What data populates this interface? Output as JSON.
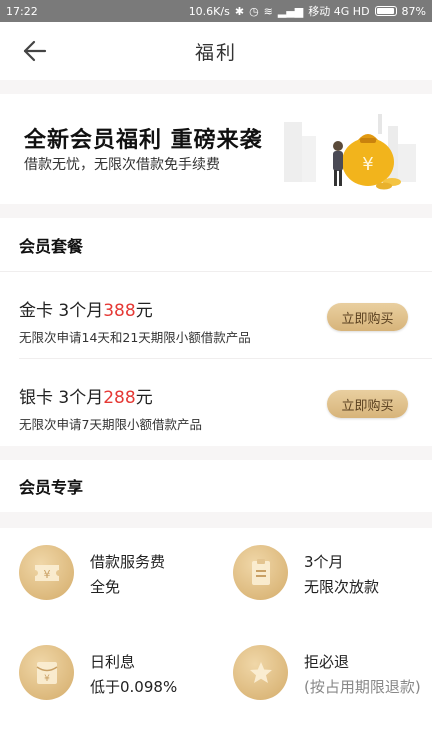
{
  "status_bar": {
    "time": "17:22",
    "network_speed": "10.6K/s",
    "carrier": "移动 4G HD",
    "battery": "87%"
  },
  "nav": {
    "title": "福利",
    "back_icon": "arrow-left-icon"
  },
  "banner": {
    "title": "全新会员福利 重磅来袭",
    "subtitle": "借款无忧，无限次借款免手续费"
  },
  "packages": {
    "header": "会员套餐",
    "items": [
      {
        "name": "金卡 3个月",
        "price": "388",
        "unit": "元",
        "description": "无限次申请14天和21天期限小额借款产品",
        "button": "立即购买"
      },
      {
        "name": "银卡 3个月",
        "price": "288",
        "unit": "元",
        "description": "无限次申请7天期限小额借款产品",
        "button": "立即购买"
      }
    ]
  },
  "perks": {
    "header": "会员专享",
    "items": [
      {
        "icon": "ticket-icon",
        "line1": "借款服务费",
        "line2": "全免"
      },
      {
        "icon": "document-icon",
        "line1": "3个月",
        "line2": "无限次放款"
      },
      {
        "icon": "red-envelope-icon",
        "line1": "日利息",
        "line2": "低于0.098%"
      },
      {
        "icon": "star-icon",
        "line1": "拒必退",
        "line2": "(按占用期限退款)"
      }
    ]
  },
  "colors": {
    "accent_gold": "#d7b47a",
    "price_red": "#e53935"
  }
}
